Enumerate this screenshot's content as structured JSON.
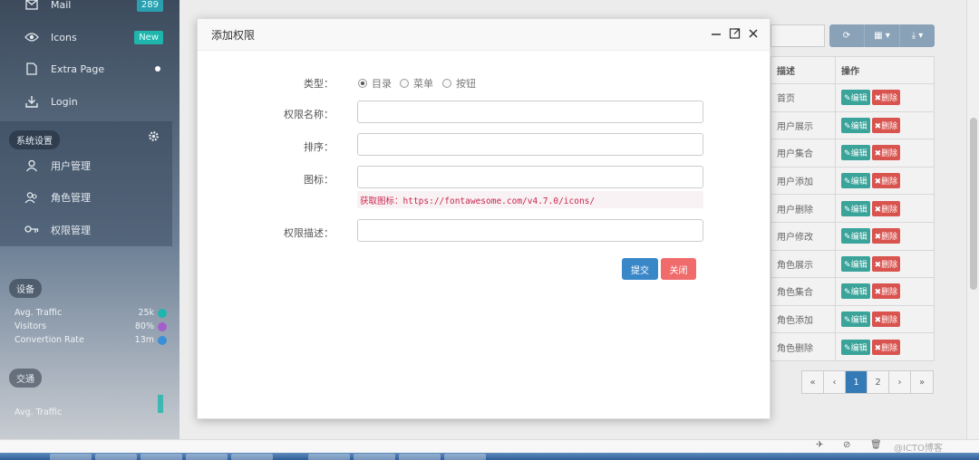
{
  "sidebar": {
    "items": [
      {
        "label": "Mail",
        "badge": "289",
        "icon": "mail-icon"
      },
      {
        "label": "Icons",
        "badge": "New",
        "icon": "eye-icon"
      },
      {
        "label": "Extra Page",
        "icon": "file-icon"
      },
      {
        "label": "Login",
        "icon": "download-icon"
      }
    ],
    "settings_title": "系统设置",
    "settings_items": [
      {
        "label": "用户管理",
        "icon": "user-icon"
      },
      {
        "label": "角色管理",
        "icon": "users-icon"
      },
      {
        "label": "权限管理",
        "icon": "key-icon"
      }
    ],
    "device_title": "设备",
    "stats": [
      {
        "label": "Avg. Traffic",
        "value": "25k",
        "color": "#1fb5ad"
      },
      {
        "label": "Visitors",
        "value": "80%",
        "color": "#a45ecb"
      },
      {
        "label": "Convertion Rate",
        "value": "13m",
        "color": "#3a8fd8"
      }
    ],
    "traffic_title": "交通",
    "traffic_stat": "Avg. Traffic"
  },
  "table": {
    "headers": [
      "描述",
      "操作"
    ],
    "rows": [
      "首页",
      "用户展示",
      "用户集合",
      "用户添加",
      "用户删除",
      "用户修改",
      "角色展示",
      "角色集合",
      "角色添加",
      "角色删除"
    ],
    "edit_label": "编辑",
    "delete_label": "删除",
    "pager": [
      "«",
      "‹",
      "1",
      "2",
      "›",
      "»"
    ],
    "active_page": "1"
  },
  "dialog": {
    "title": "添加权限",
    "type_label": "类型：",
    "type_options": [
      "目录",
      "菜单",
      "按钮"
    ],
    "type_selected": "目录",
    "name_label": "权限名称：",
    "order_label": "排序：",
    "icon_label": "图标：",
    "icon_hint": "获取图标：https://fontawesome.com/v4.7.0/icons/",
    "desc_label": "权限描述：",
    "submit_label": "提交",
    "close_label": "关闭"
  },
  "watermark": "@ICTO博客"
}
